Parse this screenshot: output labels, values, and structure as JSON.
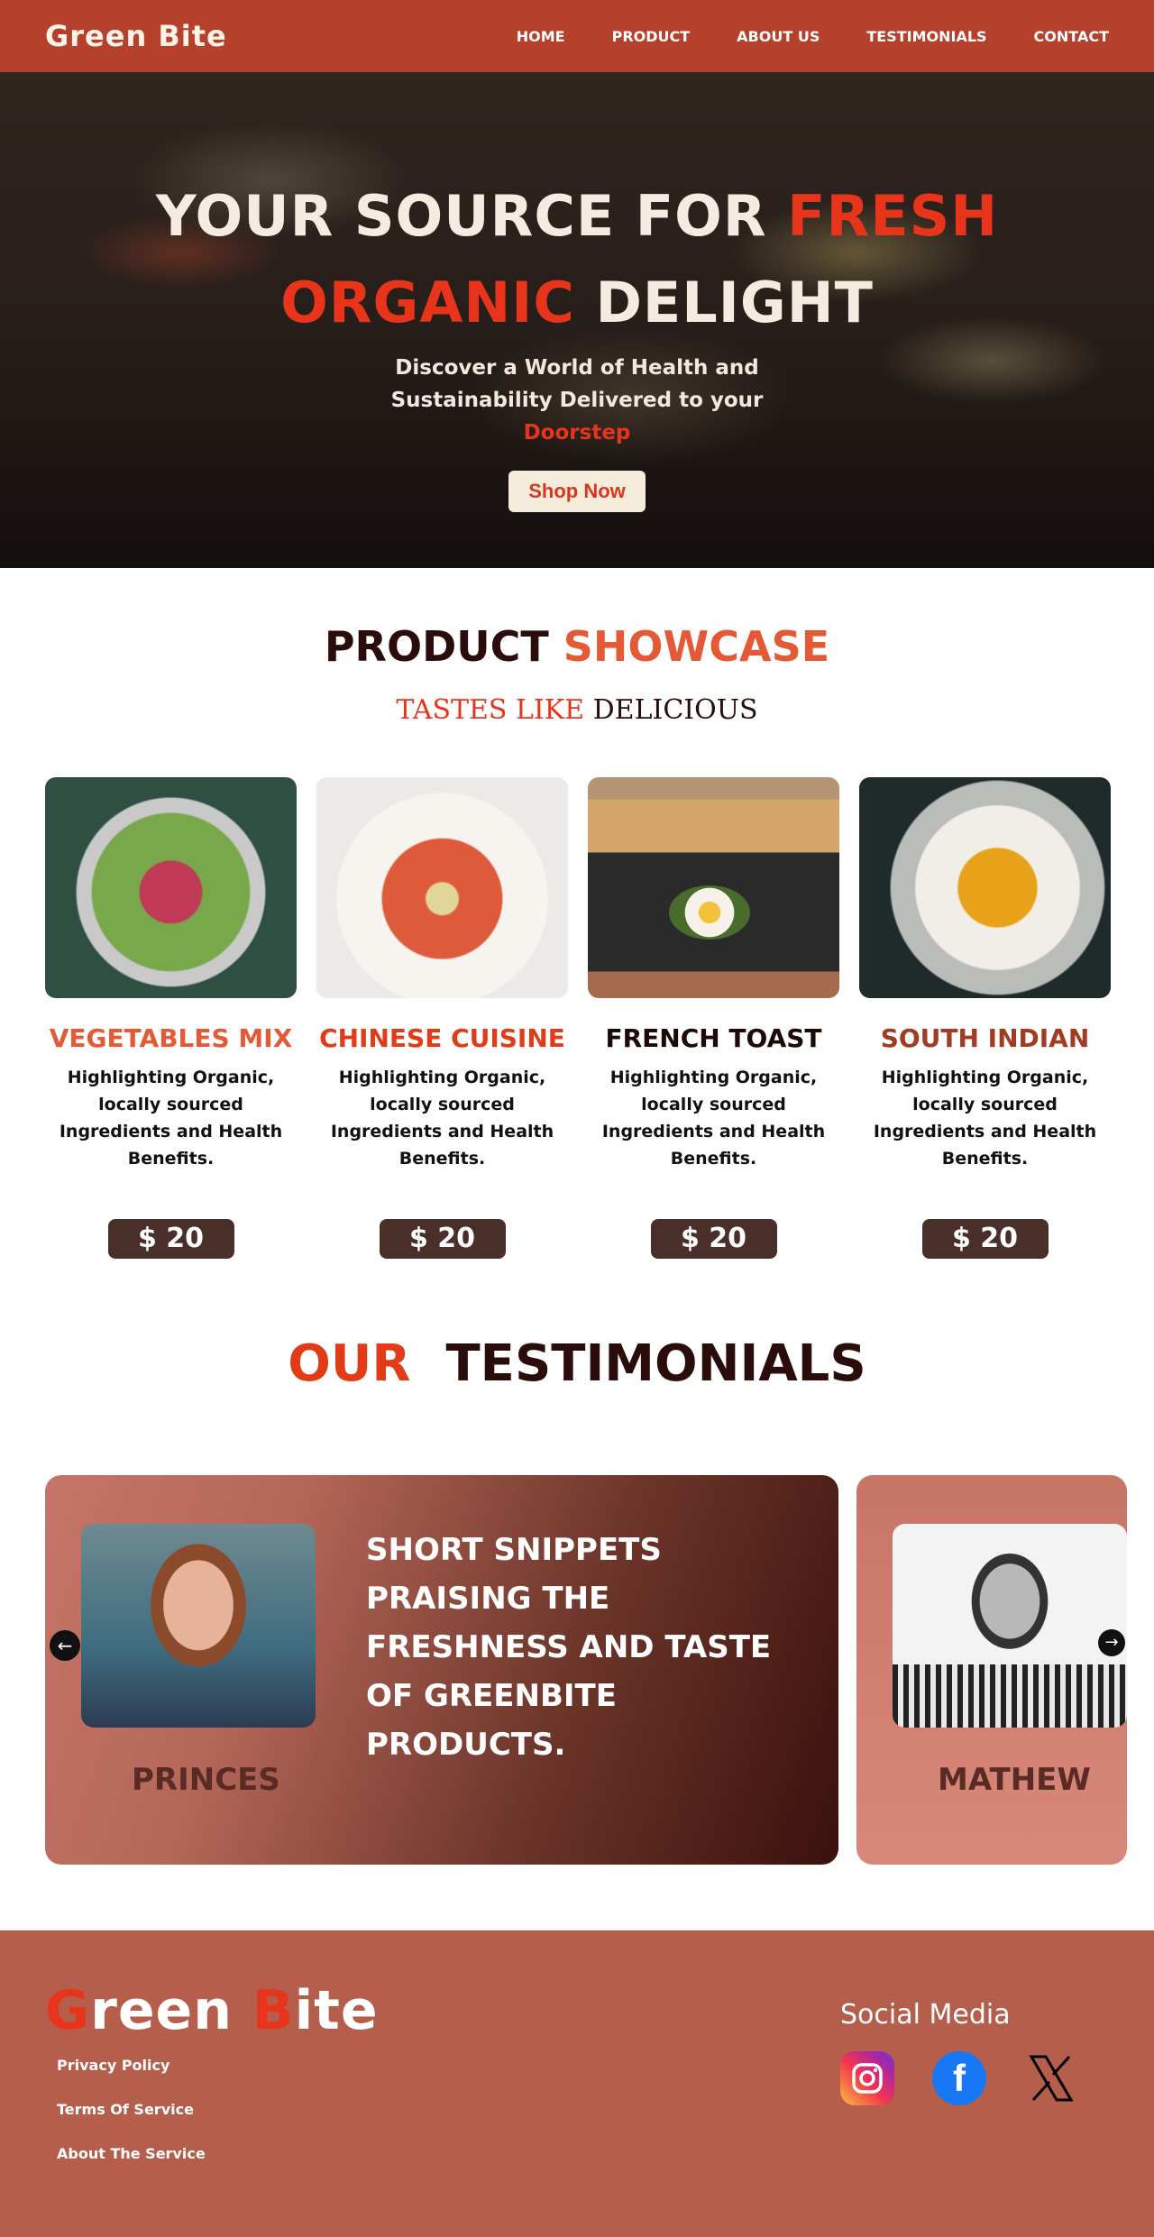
{
  "nav": {
    "brand": "Green Bite",
    "links": [
      "HOME",
      "PRODUCT",
      "ABOUT US",
      "TESTIMONIALS",
      "CONTACT"
    ]
  },
  "hero": {
    "title_part1": "YOUR SOURCE FOR ",
    "title_hot1": "FRESH",
    "title_hot2": "ORGANIC",
    "title_part2": " DELIGHT",
    "subtitle_main": "Discover a World of Health and Sustainability Delivered to your ",
    "subtitle_hot": "Doorstep",
    "cta": "Shop Now"
  },
  "showcase": {
    "title_part1": "PRODUCT ",
    "title_hot": "SHOWCASE",
    "tag_hot": "TASTES LIKE",
    "tag_rest": " DELICIOUS",
    "products": [
      {
        "name": "VEGETABLES MIX",
        "color": "#e55a36",
        "desc": "Highlighting Organic, locally sourced Ingredients and Health Benefits.",
        "price": "$ 20"
      },
      {
        "name": "CHINESE CUISINE",
        "color": "#e23b18",
        "desc": "Highlighting Organic, locally sourced Ingredients and Health Benefits.",
        "price": "$ 20"
      },
      {
        "name": "FRENCH TOAST",
        "color": "#1c0a08",
        "desc": "Highlighting Organic, locally sourced Ingredients and Health Benefits.",
        "price": "$ 20"
      },
      {
        "name": "SOUTH INDIAN",
        "color": "#a33a22",
        "desc": "Highlighting Organic, locally sourced Ingredients and Health Benefits.",
        "price": "$ 20"
      }
    ]
  },
  "testimonials": {
    "title_hot": "OUR",
    "title_rest": "TESTIMONIALS",
    "items": [
      {
        "name": "PRINCES",
        "quote": "SHORT SNIPPETS PRAISING THE FRESHNESS AND TASTE OF GREENBITE PRODUCTS."
      },
      {
        "name": "MATHEW"
      }
    ],
    "arrow_left_icon": "arrow-left-icon",
    "arrow_right_icon": "arrow-right-icon"
  },
  "footer": {
    "brand_g": "G",
    "brand_reen": "reen ",
    "brand_b": "B",
    "brand_ite": "ite",
    "links": [
      "Privacy Policy",
      "Terms Of Service",
      "About The Service"
    ],
    "social_title": "Social Media",
    "socials": [
      "instagram-icon",
      "facebook-icon",
      "x-icon"
    ]
  },
  "colors": {
    "nav": "#b5412c",
    "accent": "#e8341a",
    "footer": "#b55e4c",
    "price": "#4a2e2a"
  }
}
